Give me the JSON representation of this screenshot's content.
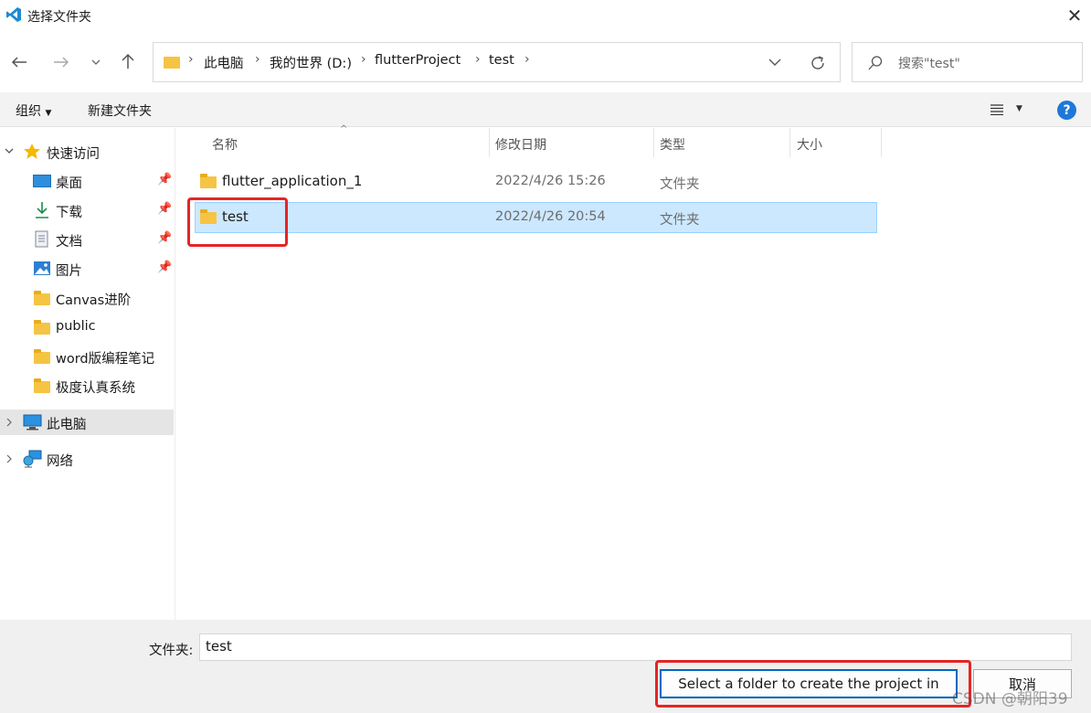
{
  "window": {
    "title": "选择文件夹"
  },
  "address": {
    "crumbs": [
      "此电脑",
      "我的世界 (D:)",
      "flutterProject",
      "test"
    ]
  },
  "search": {
    "placeholder": "搜索\"test\""
  },
  "toolbar": {
    "organize_label": "组织",
    "new_folder_label": "新建文件夹",
    "help_label": "?"
  },
  "sidebar": {
    "quick_access": "快速访问",
    "items": [
      {
        "label": "桌面",
        "icon": "desktop-icon",
        "pinned": true
      },
      {
        "label": "下载",
        "icon": "download-icon",
        "pinned": true
      },
      {
        "label": "文档",
        "icon": "document-icon",
        "pinned": true
      },
      {
        "label": "图片",
        "icon": "pictures-icon",
        "pinned": true
      },
      {
        "label": "Canvas进阶",
        "icon": "folder-icon",
        "pinned": false
      },
      {
        "label": "public",
        "icon": "folder-icon",
        "pinned": false
      },
      {
        "label": "word版编程笔记",
        "icon": "folder-icon",
        "pinned": false
      },
      {
        "label": "极度认真系统",
        "icon": "folder-icon",
        "pinned": false
      }
    ],
    "this_pc": "此电脑",
    "network": "网络"
  },
  "columns": {
    "name": "名称",
    "modified": "修改日期",
    "type": "类型",
    "size": "大小"
  },
  "files": [
    {
      "name": "flutter_application_1",
      "modified": "2022/4/26 15:26",
      "type": "文件夹",
      "selected": false
    },
    {
      "name": "test",
      "modified": "2022/4/26 20:54",
      "type": "文件夹",
      "selected": true
    }
  ],
  "footer": {
    "folder_label": "文件夹:",
    "folder_value": "test",
    "select_button": "Select a folder to create the project in",
    "cancel_button": "取消"
  },
  "watermark": "CSDN @朝阳39",
  "colors": {
    "selection_bg": "#cce8ff",
    "selection_border": "#99d1ff",
    "highlight_red": "#e52525",
    "help_blue": "#1e78d7"
  }
}
